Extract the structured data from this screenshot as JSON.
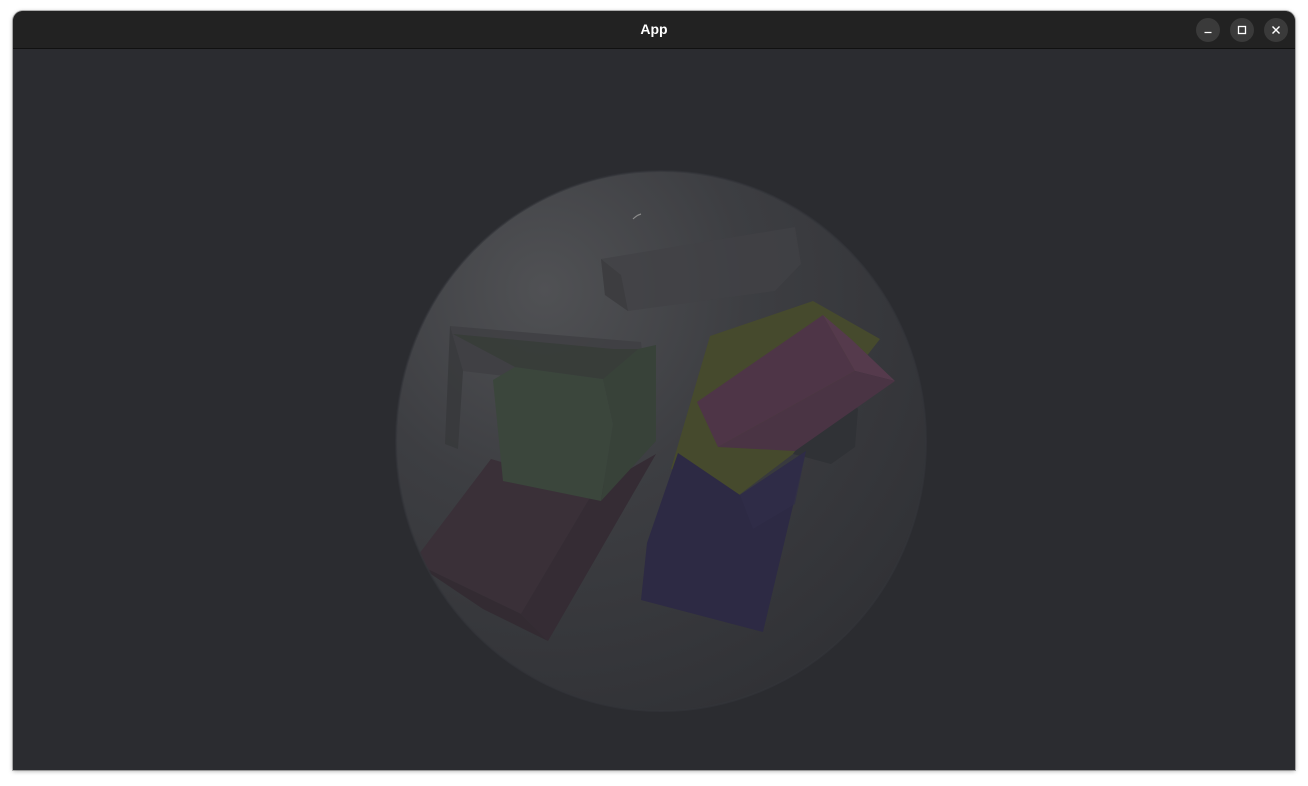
{
  "window": {
    "title": "App",
    "controls": {
      "minimize_icon": "minimize-icon",
      "maximize_icon": "maximize-icon",
      "close_icon": "close-icon"
    }
  },
  "scene": {
    "background_color": "#2b2c30",
    "sphere_color": "#3d3e42",
    "objects": [
      {
        "name": "dark-box",
        "color": "#3b3b3b"
      },
      {
        "name": "green-box",
        "color": "#3f4a40"
      },
      {
        "name": "maroon-box",
        "color": "#3f3038"
      },
      {
        "name": "olive-box",
        "color": "#4a4d2f"
      },
      {
        "name": "magenta-box",
        "color": "#523748"
      },
      {
        "name": "navy-box",
        "color": "#2e2b46"
      }
    ]
  }
}
